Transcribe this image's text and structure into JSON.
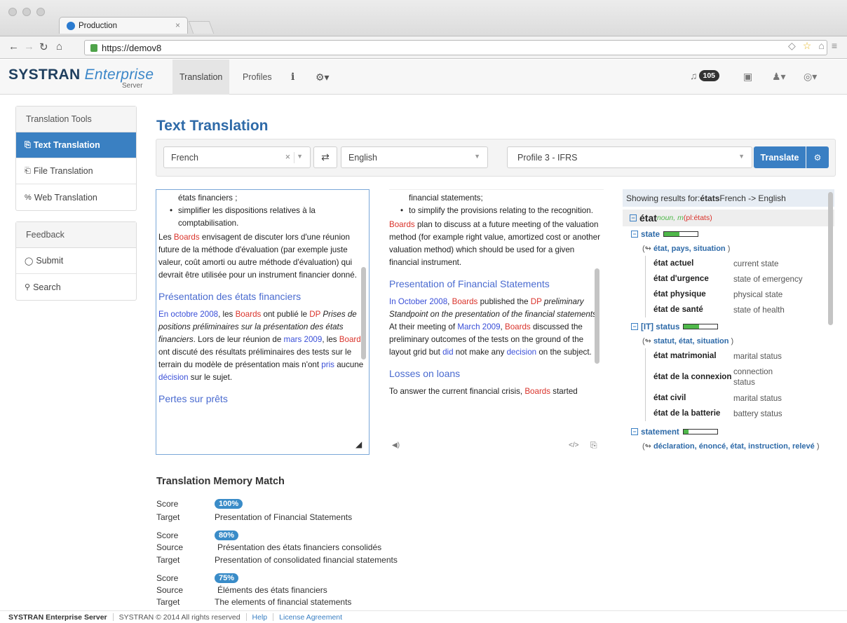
{
  "browser": {
    "tab_title": "Production",
    "tab_close": "×",
    "url": "https://demov8"
  },
  "app": {
    "brand": "SYSTRAN",
    "brand_italic": "Enterprise",
    "brand_sub": "Server",
    "nav": [
      {
        "label": "Translation"
      },
      {
        "label": "Profiles"
      }
    ],
    "notifications": "105"
  },
  "sidebar": {
    "tools_title": "Translation Tools",
    "tools": [
      {
        "label": "Text Translation",
        "icon": "text-icon"
      },
      {
        "label": "File Translation",
        "icon": "file-icon"
      },
      {
        "label": "Web Translation",
        "icon": "link-icon"
      }
    ],
    "feedback_title": "Feedback",
    "feedback": [
      {
        "label": "Submit",
        "icon": "chat-icon"
      },
      {
        "label": "Search",
        "icon": "search-icon"
      }
    ]
  },
  "main": {
    "title": "Text Translation",
    "source_lang": "French",
    "target_lang": "English",
    "profile": "Profile 3 - IFRS",
    "translate_label": "Translate"
  },
  "source": {
    "p0": "états financiers ;",
    "li1": "simplifier les dispositions relatives à la comptabilisation.",
    "p1_a": "Les ",
    "p1_boards": "Boards",
    "p1_b": " envisagent de discuter lors d'une réunion future de la méthode d'évaluation (par exemple juste valeur, coût amorti ou autre méthode d'évaluation) qui devrait être utilisée pour un instrument financier donné.",
    "h1": "Présentation des états financiers",
    "p2_date": "En octobre 2008",
    "p2_a": ", les ",
    "p2_boards": "Boards",
    "p2_b": " ont publié le ",
    "p2_dp": "DP",
    "p2_c": " ",
    "p2_title": "Prises de positions préliminaires sur la présentation des états financiers",
    "p2_d": ". Lors de leur réunion de ",
    "p2_date2": "mars 2009",
    "p2_e": ", les ",
    "p2_boards2": "Boards",
    "p2_f": " ont discuté des résultats préliminaires des tests sur le terrain du modèle de présentation mais n'ont ",
    "p2_pris": "pris",
    "p2_g": " aucune ",
    "p2_decision": "décision",
    "p2_h": " sur le sujet.",
    "h2": "Pertes sur prêts"
  },
  "target": {
    "p0": "financial statements;",
    "li1": "to simplify the provisions relating to the recognition.",
    "p1_boards": "Boards",
    "p1_a": " plan to discuss at a future meeting of the valuation method (for example right value, amortized cost or another valuation method) which should be used for a given financial instrument.",
    "h1": "Presentation of Financial Statements",
    "p2_date": "In October 2008",
    "p2_a": ", ",
    "p2_boards": "Boards",
    "p2_b": " published the ",
    "p2_dp": "DP",
    "p2_c": " ",
    "p2_title": "preliminary Standpoint on the presentation of the financial statements",
    "p2_d": ". At their meeting of ",
    "p2_date2": "March 2009",
    "p2_e": ", ",
    "p2_boards2": "Boards",
    "p2_f": " discussed the preliminary outcomes of the tests on the ground of the layout grid but ",
    "p2_did": "did",
    "p2_g": " not make any ",
    "p2_decision": "decision",
    "p2_h": " on the subject.",
    "h2": "Losses on loans",
    "p3_a": "To answer the current financial crisis, ",
    "p3_boards": "Boards",
    "p3_b": " started"
  },
  "dictionary": {
    "header_prefix": "Showing results for:",
    "header_word": "états",
    "header_suffix": " French -> English",
    "entry_word": "état",
    "entry_pos": " noun, m ",
    "entry_plural": " (pl:états)",
    "senses": [
      {
        "label": "state",
        "strength": 0.45,
        "synonyms": "état, pays, situation",
        "pairs": [
          {
            "fr": "état actuel",
            "en": "current state"
          },
          {
            "fr": "état d'urgence",
            "en": "state of emergency"
          },
          {
            "fr": "état physique",
            "en": "physical state"
          },
          {
            "fr": "état de santé",
            "en": "state of health"
          }
        ]
      },
      {
        "label": "[IT] status",
        "strength": 0.45,
        "synonyms": "statut, état, situation",
        "pairs": [
          {
            "fr": "état matrimonial",
            "en": "marital status"
          },
          {
            "fr": "état de la connexion",
            "en": "connection status"
          },
          {
            "fr": "état civil",
            "en": "marital status"
          },
          {
            "fr": "état de la batterie",
            "en": "battery status"
          }
        ]
      },
      {
        "label": "statement",
        "strength": 0.15,
        "synonyms": "déclaration, énoncé, état, instruction, relevé"
      }
    ]
  },
  "tm": {
    "title": "Translation Memory Match",
    "score_label": "Score",
    "source_label": "Source",
    "target_label": "Target",
    "matches": [
      {
        "score": "100%",
        "target": "Presentation of Financial Statements"
      },
      {
        "score": "80%",
        "source": "Présentation des états financiers consolidés",
        "target": "Presentation of consolidated financial statements"
      },
      {
        "score": "75%",
        "source": "Éléments des états financiers",
        "target": "The elements of financial statements"
      }
    ]
  },
  "footer": {
    "product": "SYSTRAN Enterprise Server",
    "copyright": "SYSTRAN © 2014 All rights reserved",
    "help": "Help",
    "license": "License Agreement"
  },
  "colors": {
    "primary": "#3a7fc3",
    "entity_red": "#d9322a",
    "heading_blue": "#4a6bd0"
  }
}
